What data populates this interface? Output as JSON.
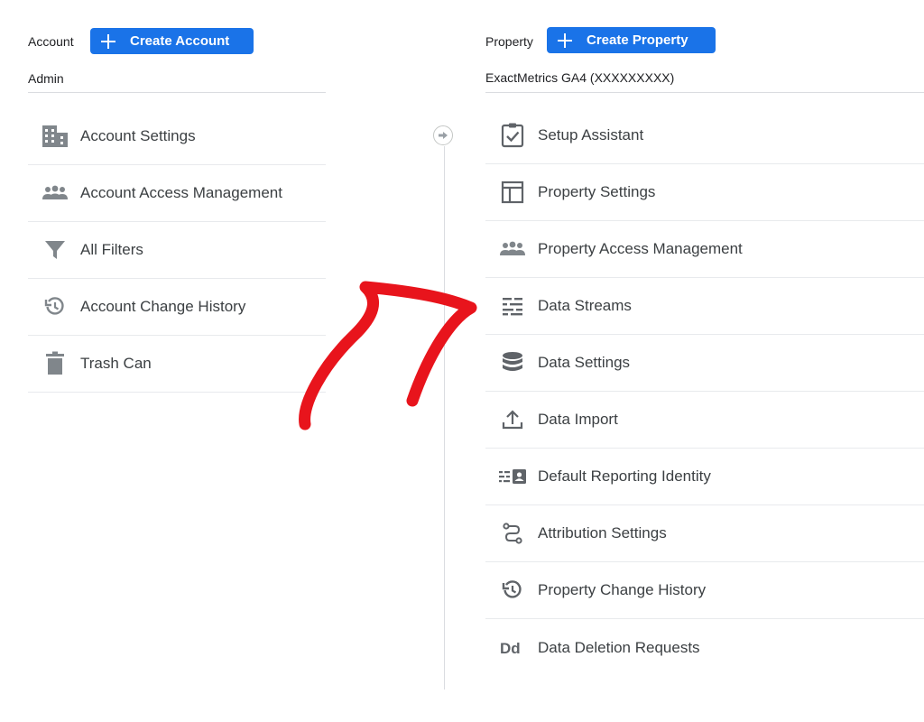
{
  "account": {
    "header_label": "Account",
    "create_button": "Create Account",
    "selected": "Admin",
    "items": [
      {
        "label": "Account Settings",
        "icon": "building-icon"
      },
      {
        "label": "Account Access Management",
        "icon": "people-icon"
      },
      {
        "label": "All Filters",
        "icon": "filter-icon"
      },
      {
        "label": "Account Change History",
        "icon": "history-icon"
      },
      {
        "label": "Trash Can",
        "icon": "trash-icon"
      }
    ]
  },
  "property": {
    "header_label": "Property",
    "create_button": "Create Property",
    "selected": "ExactMetrics GA4 (XXXXXXXXX)",
    "items": [
      {
        "label": "Setup Assistant",
        "icon": "clipboard-check-icon"
      },
      {
        "label": "Property Settings",
        "icon": "layout-icon"
      },
      {
        "label": "Property Access Management",
        "icon": "people-icon"
      },
      {
        "label": "Data Streams",
        "icon": "streams-icon"
      },
      {
        "label": "Data Settings",
        "icon": "database-icon"
      },
      {
        "label": "Data Import",
        "icon": "upload-icon"
      },
      {
        "label": "Default Reporting Identity",
        "icon": "identity-icon"
      },
      {
        "label": "Attribution Settings",
        "icon": "attribution-icon"
      },
      {
        "label": "Property Change History",
        "icon": "history-icon"
      },
      {
        "label": "Data Deletion Requests",
        "icon": "data-deletion-icon"
      }
    ]
  },
  "colors": {
    "accent": "#1a73e8",
    "icon_gray": "#5f6368",
    "annotation_arrow": "#e8141c"
  }
}
